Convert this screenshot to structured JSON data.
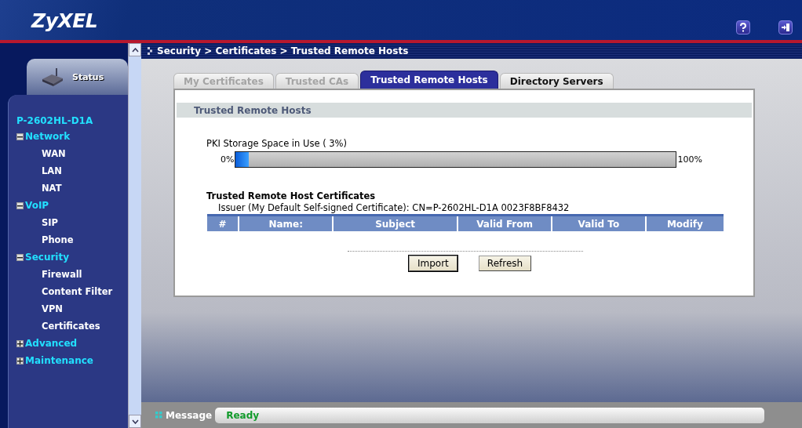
{
  "header": {
    "logo": "ZyXEL"
  },
  "sidebar": {
    "status_tab": "Status",
    "device": "P-2602HL-D1A",
    "tree": [
      {
        "label": "Network",
        "expanded": true,
        "children": [
          {
            "label": "WAN"
          },
          {
            "label": "LAN"
          },
          {
            "label": "NAT"
          }
        ]
      },
      {
        "label": "VoIP",
        "expanded": true,
        "children": [
          {
            "label": "SIP"
          },
          {
            "label": "Phone"
          }
        ]
      },
      {
        "label": "Security",
        "expanded": true,
        "children": [
          {
            "label": "Firewall"
          },
          {
            "label": "Content Filter"
          },
          {
            "label": "VPN"
          },
          {
            "label": "Certificates"
          }
        ]
      },
      {
        "label": "Advanced",
        "expanded": false
      },
      {
        "label": "Maintenance",
        "expanded": false
      }
    ]
  },
  "breadcrumb": "Security > Certificates > Trusted Remote Hosts",
  "tabs": [
    {
      "label": "My Certificates",
      "selected": false
    },
    {
      "label": "Trusted CAs",
      "selected": false
    },
    {
      "label": "Trusted Remote Hosts",
      "selected": true
    },
    {
      "label": "Directory Servers",
      "selected": false
    }
  ],
  "panel": {
    "title": "Trusted Remote Hosts",
    "storage": {
      "label": "PKI Storage Space in Use ( 3%)",
      "min": "0%",
      "max": "100%",
      "level": 0.03
    },
    "certificates_title": "Trusted Remote Host Certificates",
    "issuer": "Issuer (My Default Self-signed Certificate): CN=P-2602HL-D1A 0023F8BF8432",
    "table": {
      "columns": [
        "#",
        "Name:",
        "Subject",
        "Valid From",
        "Valid To",
        "Modify"
      ]
    },
    "buttons": [
      "Import",
      "Refresh"
    ]
  },
  "status_bar": {
    "label": "Message",
    "message": "Ready"
  }
}
